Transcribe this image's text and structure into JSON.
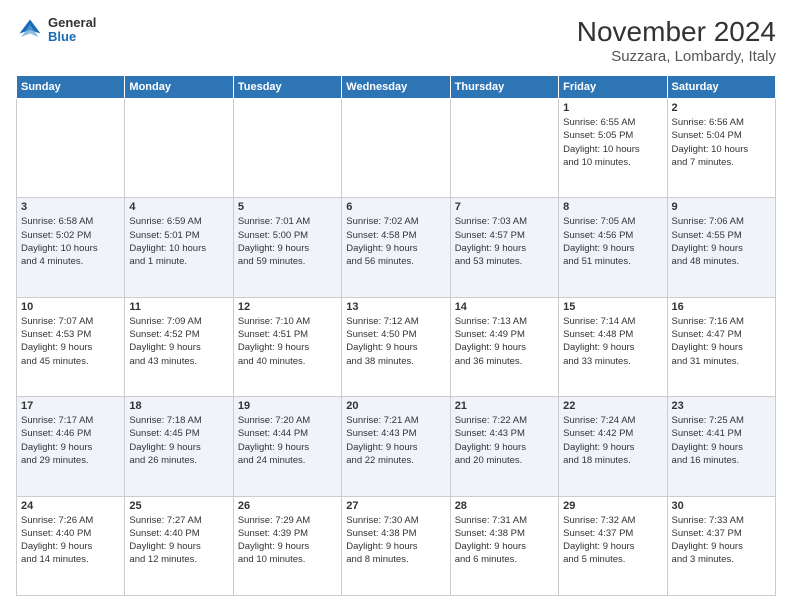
{
  "header": {
    "logo": {
      "line1": "General",
      "line2": "Blue"
    },
    "title": "November 2024",
    "subtitle": "Suzzara, Lombardy, Italy"
  },
  "weekdays": [
    "Sunday",
    "Monday",
    "Tuesday",
    "Wednesday",
    "Thursday",
    "Friday",
    "Saturday"
  ],
  "weeks": [
    [
      {
        "day": "",
        "info": ""
      },
      {
        "day": "",
        "info": ""
      },
      {
        "day": "",
        "info": ""
      },
      {
        "day": "",
        "info": ""
      },
      {
        "day": "",
        "info": ""
      },
      {
        "day": "1",
        "info": "Sunrise: 6:55 AM\nSunset: 5:05 PM\nDaylight: 10 hours\nand 10 minutes."
      },
      {
        "day": "2",
        "info": "Sunrise: 6:56 AM\nSunset: 5:04 PM\nDaylight: 10 hours\nand 7 minutes."
      }
    ],
    [
      {
        "day": "3",
        "info": "Sunrise: 6:58 AM\nSunset: 5:02 PM\nDaylight: 10 hours\nand 4 minutes."
      },
      {
        "day": "4",
        "info": "Sunrise: 6:59 AM\nSunset: 5:01 PM\nDaylight: 10 hours\nand 1 minute."
      },
      {
        "day": "5",
        "info": "Sunrise: 7:01 AM\nSunset: 5:00 PM\nDaylight: 9 hours\nand 59 minutes."
      },
      {
        "day": "6",
        "info": "Sunrise: 7:02 AM\nSunset: 4:58 PM\nDaylight: 9 hours\nand 56 minutes."
      },
      {
        "day": "7",
        "info": "Sunrise: 7:03 AM\nSunset: 4:57 PM\nDaylight: 9 hours\nand 53 minutes."
      },
      {
        "day": "8",
        "info": "Sunrise: 7:05 AM\nSunset: 4:56 PM\nDaylight: 9 hours\nand 51 minutes."
      },
      {
        "day": "9",
        "info": "Sunrise: 7:06 AM\nSunset: 4:55 PM\nDaylight: 9 hours\nand 48 minutes."
      }
    ],
    [
      {
        "day": "10",
        "info": "Sunrise: 7:07 AM\nSunset: 4:53 PM\nDaylight: 9 hours\nand 45 minutes."
      },
      {
        "day": "11",
        "info": "Sunrise: 7:09 AM\nSunset: 4:52 PM\nDaylight: 9 hours\nand 43 minutes."
      },
      {
        "day": "12",
        "info": "Sunrise: 7:10 AM\nSunset: 4:51 PM\nDaylight: 9 hours\nand 40 minutes."
      },
      {
        "day": "13",
        "info": "Sunrise: 7:12 AM\nSunset: 4:50 PM\nDaylight: 9 hours\nand 38 minutes."
      },
      {
        "day": "14",
        "info": "Sunrise: 7:13 AM\nSunset: 4:49 PM\nDaylight: 9 hours\nand 36 minutes."
      },
      {
        "day": "15",
        "info": "Sunrise: 7:14 AM\nSunset: 4:48 PM\nDaylight: 9 hours\nand 33 minutes."
      },
      {
        "day": "16",
        "info": "Sunrise: 7:16 AM\nSunset: 4:47 PM\nDaylight: 9 hours\nand 31 minutes."
      }
    ],
    [
      {
        "day": "17",
        "info": "Sunrise: 7:17 AM\nSunset: 4:46 PM\nDaylight: 9 hours\nand 29 minutes."
      },
      {
        "day": "18",
        "info": "Sunrise: 7:18 AM\nSunset: 4:45 PM\nDaylight: 9 hours\nand 26 minutes."
      },
      {
        "day": "19",
        "info": "Sunrise: 7:20 AM\nSunset: 4:44 PM\nDaylight: 9 hours\nand 24 minutes."
      },
      {
        "day": "20",
        "info": "Sunrise: 7:21 AM\nSunset: 4:43 PM\nDaylight: 9 hours\nand 22 minutes."
      },
      {
        "day": "21",
        "info": "Sunrise: 7:22 AM\nSunset: 4:43 PM\nDaylight: 9 hours\nand 20 minutes."
      },
      {
        "day": "22",
        "info": "Sunrise: 7:24 AM\nSunset: 4:42 PM\nDaylight: 9 hours\nand 18 minutes."
      },
      {
        "day": "23",
        "info": "Sunrise: 7:25 AM\nSunset: 4:41 PM\nDaylight: 9 hours\nand 16 minutes."
      }
    ],
    [
      {
        "day": "24",
        "info": "Sunrise: 7:26 AM\nSunset: 4:40 PM\nDaylight: 9 hours\nand 14 minutes."
      },
      {
        "day": "25",
        "info": "Sunrise: 7:27 AM\nSunset: 4:40 PM\nDaylight: 9 hours\nand 12 minutes."
      },
      {
        "day": "26",
        "info": "Sunrise: 7:29 AM\nSunset: 4:39 PM\nDaylight: 9 hours\nand 10 minutes."
      },
      {
        "day": "27",
        "info": "Sunrise: 7:30 AM\nSunset: 4:38 PM\nDaylight: 9 hours\nand 8 minutes."
      },
      {
        "day": "28",
        "info": "Sunrise: 7:31 AM\nSunset: 4:38 PM\nDaylight: 9 hours\nand 6 minutes."
      },
      {
        "day": "29",
        "info": "Sunrise: 7:32 AM\nSunset: 4:37 PM\nDaylight: 9 hours\nand 5 minutes."
      },
      {
        "day": "30",
        "info": "Sunrise: 7:33 AM\nSunset: 4:37 PM\nDaylight: 9 hours\nand 3 minutes."
      }
    ]
  ]
}
